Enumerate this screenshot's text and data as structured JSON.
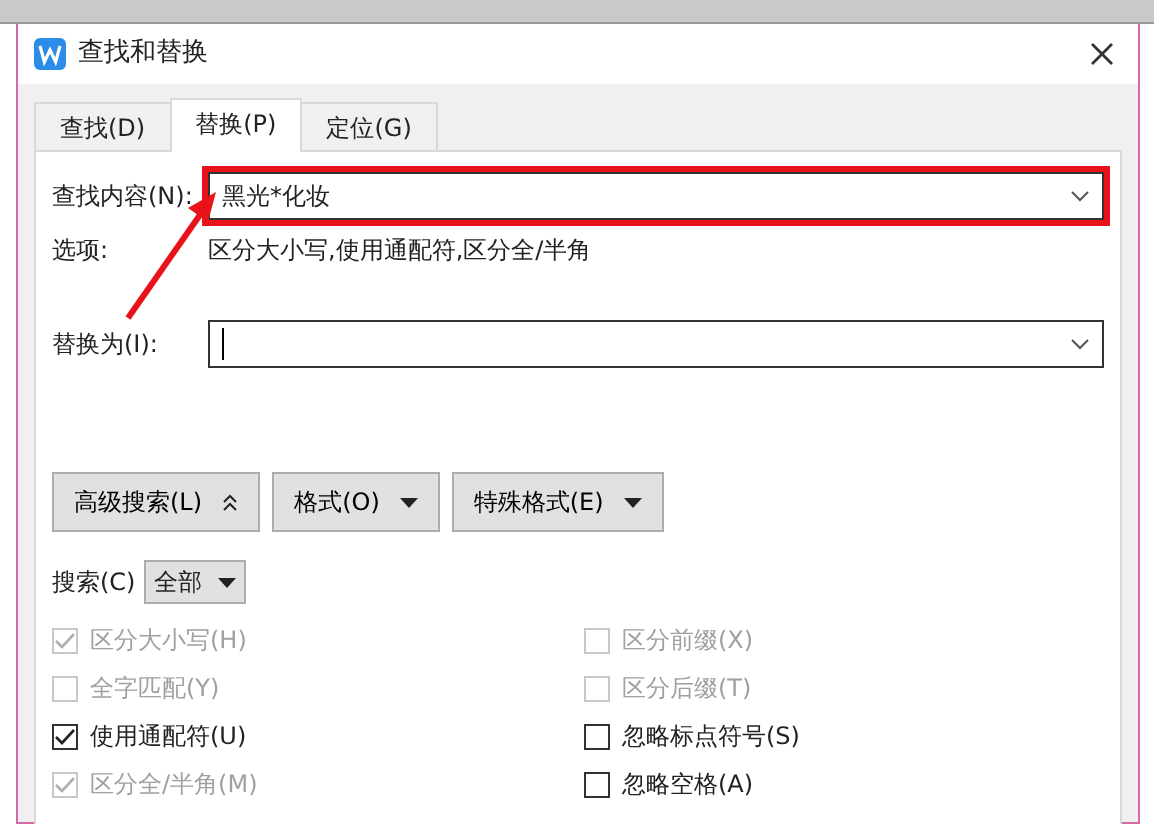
{
  "window": {
    "title": "查找和替换"
  },
  "tabs": [
    {
      "label": "查找(D)",
      "selected": false
    },
    {
      "label": "替换(P)",
      "selected": true
    },
    {
      "label": "定位(G)",
      "selected": false
    }
  ],
  "find": {
    "label": "查找内容(N):",
    "value": "黑光*化妆",
    "highlighted": true
  },
  "options": {
    "label": "选项:",
    "value": "区分大小写,使用通配符,区分全/半角"
  },
  "replace": {
    "label": "替换为(I):"
  },
  "buttons": [
    {
      "label": "高级搜索(L)",
      "kind": "collapse"
    },
    {
      "label": "格式(O)",
      "kind": "dropdown"
    },
    {
      "label": "特殊格式(E)",
      "kind": "dropdown"
    }
  ],
  "search": {
    "label": "搜索(C)",
    "value": "全部"
  },
  "checkboxes": [
    {
      "label": "区分大小写(H)",
      "checked": true,
      "disabled": true
    },
    {
      "label": "区分前缀(X)",
      "checked": false,
      "disabled": true
    },
    {
      "label": "全字匹配(Y)",
      "checked": false,
      "disabled": true
    },
    {
      "label": "区分后缀(T)",
      "checked": false,
      "disabled": true
    },
    {
      "label": "使用通配符(U)",
      "checked": true,
      "disabled": false
    },
    {
      "label": "忽略标点符号(S)",
      "checked": false,
      "disabled": false
    },
    {
      "label": "区分全/半角(M)",
      "checked": true,
      "disabled": true
    },
    {
      "label": "忽略空格(A)",
      "checked": false,
      "disabled": false
    }
  ]
}
